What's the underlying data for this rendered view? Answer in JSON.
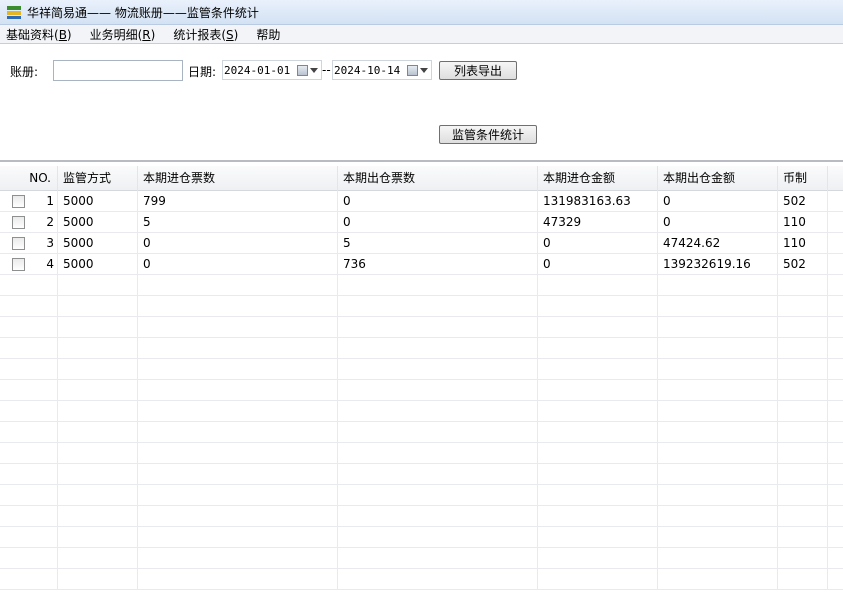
{
  "window": {
    "title": "华祥简易通—— 物流账册——监管条件统计"
  },
  "menu": [
    {
      "label": "基础资料(",
      "key": "B",
      "end": ")"
    },
    {
      "label": "业务明细(",
      "key": "R",
      "end": ")"
    },
    {
      "label": "统计报表(",
      "key": "S",
      "end": ")"
    },
    {
      "label": "帮助",
      "key": "",
      "end": ""
    }
  ],
  "filters": {
    "account_label": "账册:",
    "account_value": "",
    "date_label": "日期:",
    "date_from": "2024-01-01",
    "date_sep": "--",
    "date_to": "2024-10-14",
    "export_button": "列表导出",
    "stat_button": "监管条件统计"
  },
  "table": {
    "headers": [
      "NO.",
      "监管方式",
      "本期进仓票数",
      "本期出仓票数",
      "本期进仓金额",
      "本期出仓金额",
      "币制"
    ],
    "rows": [
      [
        "1",
        "5000",
        "799",
        "0",
        "131983163.63",
        "0",
        "502"
      ],
      [
        "2",
        "5000",
        "5",
        "0",
        "47329",
        "0",
        "110"
      ],
      [
        "3",
        "5000",
        "0",
        "5",
        "0",
        "47424.62",
        "110"
      ],
      [
        "4",
        "5000",
        "0",
        "736",
        "0",
        "139232619.16",
        "502"
      ]
    ]
  }
}
